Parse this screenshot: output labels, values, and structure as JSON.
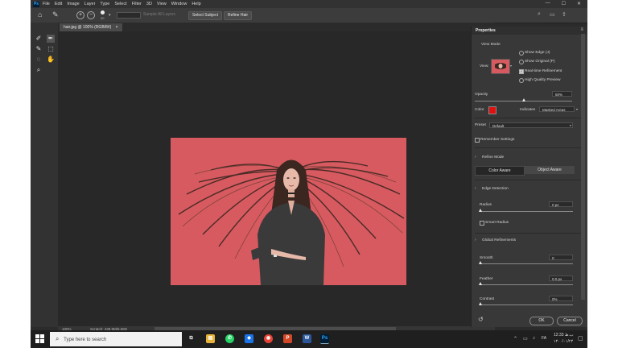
{
  "app": {
    "logo": "Ps"
  },
  "menu": [
    "File",
    "Edit",
    "Image",
    "Layer",
    "Type",
    "Select",
    "Filter",
    "3D",
    "View",
    "Window",
    "Help"
  ],
  "window_controls": {
    "minimize": "—",
    "maximize": "☐",
    "close": "✕"
  },
  "options_bar": {
    "brush_size": "20",
    "sample_all_layers": "Sample All Layers",
    "select_subject": "Select Subject",
    "refine_hair": "Refine Hair"
  },
  "document": {
    "tab_label": "hair.jpg @ 100% (RGB/8#)",
    "tab_close": "×",
    "zoom": "100%",
    "status": "Scratch: 438.9M/5.08G"
  },
  "properties": {
    "title": "Properties",
    "view_mode": {
      "label": "View Mode",
      "view_label": "View:",
      "show_edge": "Show Edge (J)",
      "show_original": "Show Original (P)",
      "realtime_refinement": "Real-time Refinement",
      "high_quality_preview": "High Quality Preview",
      "realtime_checked": true
    },
    "opacity": {
      "label": "Opacity",
      "value": "50%",
      "fraction": 0.5
    },
    "color": {
      "label": "Color",
      "swatch": "#e01010",
      "indicates_label": "Indicates",
      "indicates_value": "Masked Areas"
    },
    "preset": {
      "label": "Preset",
      "value": "Default"
    },
    "remember_settings": "Remember Settings",
    "refine_mode": {
      "label": "Refine Mode",
      "color_aware": "Color Aware",
      "object_aware": "Object Aware"
    },
    "edge_detection": {
      "label": "Edge Detection",
      "radius_label": "Radius",
      "radius_value": "0 px",
      "smart_radius": "Smart Radius"
    },
    "global_refinements": {
      "label": "Global Refinements",
      "smooth_label": "Smooth",
      "smooth_value": "0",
      "feather_label": "Feather",
      "feather_value": "0.0 px",
      "contrast_label": "Contrast",
      "contrast_value": "0%"
    },
    "ok": "OK",
    "cancel": "Cancel"
  },
  "taskbar": {
    "search_placeholder": "Type here to search",
    "time": "12:33 ب.ظ",
    "date": "۱۴۰۰/۰۱/۲۴",
    "lang": "FA"
  },
  "colors": {
    "photo_bg": "#d75a60",
    "hair": "#3b2620",
    "shirt": "#3a3a3a",
    "skin": "#e7b9a8"
  }
}
